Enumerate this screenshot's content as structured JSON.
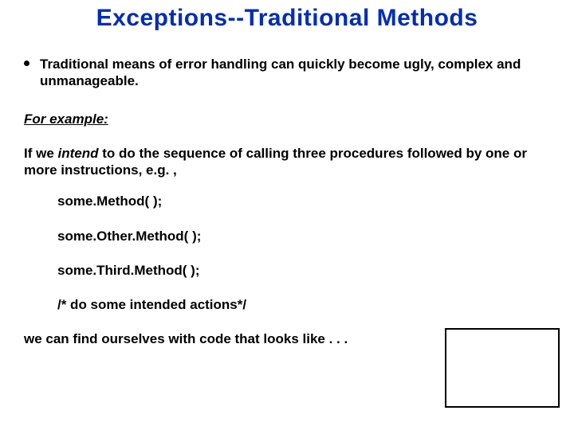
{
  "title": "Exceptions--Traditional Methods",
  "bullet": "Traditional means of error handling can quickly become ugly,  complex and unmanageable.",
  "for_example": "For example:",
  "intend_prefix": "If we ",
  "intend_italic": "intend",
  "intend_suffix": " to do the sequence of calling three procedures followed by one or more instructions, e.g. ,",
  "code": {
    "l1": "some.Method( );",
    "l2": "some.Other.Method( );",
    "l3": "some.Third.Method( );",
    "l4": "/* do some intended actions*/"
  },
  "closing": "we can find ourselves with code that looks like . . ."
}
